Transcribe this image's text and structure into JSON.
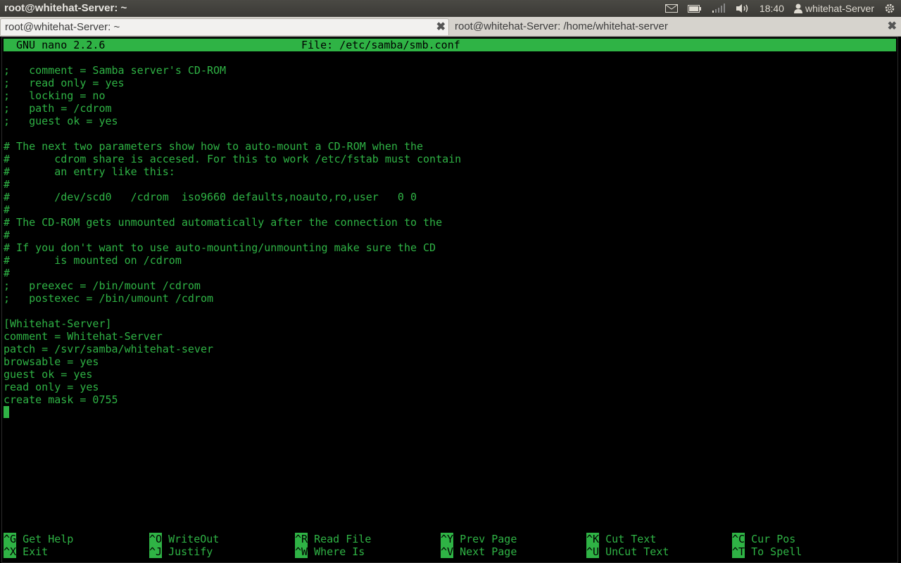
{
  "window": {
    "title": "root@whitehat-Server: ~"
  },
  "tray": {
    "time": "18:40",
    "user": "whitehat-Server",
    "icons": [
      "mail-icon",
      "battery-icon",
      "network-icon",
      "volume-icon",
      "user-icon",
      "gear-icon"
    ]
  },
  "tabs": [
    {
      "label": "root@whitehat-Server: ~",
      "active": true
    },
    {
      "label": "root@whitehat-Server: /home/whitehat-server",
      "active": false
    }
  ],
  "nano": {
    "version": "GNU nano 2.2.6",
    "file": "File: /etc/samba/smb.conf",
    "lines": [
      ";   comment = Samba server's CD-ROM",
      ";   read only = yes",
      ";   locking = no",
      ";   path = /cdrom",
      ";   guest ok = yes",
      "",
      "# The next two parameters show how to auto-mount a CD-ROM when the",
      "#       cdrom share is accesed. For this to work /etc/fstab must contain",
      "#       an entry like this:",
      "#",
      "#       /dev/scd0   /cdrom  iso9660 defaults,noauto,ro,user   0 0",
      "#",
      "# The CD-ROM gets unmounted automatically after the connection to the",
      "#",
      "# If you don't want to use auto-mounting/unmounting make sure the CD",
      "#       is mounted on /cdrom",
      "#",
      ";   preexec = /bin/mount /cdrom",
      ";   postexec = /bin/umount /cdrom",
      "",
      "[Whitehat-Server]",
      "comment = Whitehat-Server",
      "patch = /svr/samba/whitehat-sever",
      "browsable = yes",
      "guest ok = yes",
      "read only = yes",
      "create mask = 0755"
    ],
    "shortcuts_row1": [
      {
        "key": "^G",
        "label": "Get Help"
      },
      {
        "key": "^O",
        "label": "WriteOut"
      },
      {
        "key": "^R",
        "label": "Read File"
      },
      {
        "key": "^Y",
        "label": "Prev Page"
      },
      {
        "key": "^K",
        "label": "Cut Text"
      },
      {
        "key": "^C",
        "label": "Cur Pos"
      }
    ],
    "shortcuts_row2": [
      {
        "key": "^X",
        "label": "Exit"
      },
      {
        "key": "^J",
        "label": "Justify"
      },
      {
        "key": "^W",
        "label": "Where Is"
      },
      {
        "key": "^V",
        "label": "Next Page"
      },
      {
        "key": "^U",
        "label": "UnCut Text"
      },
      {
        "key": "^T",
        "label": "To Spell"
      }
    ]
  }
}
